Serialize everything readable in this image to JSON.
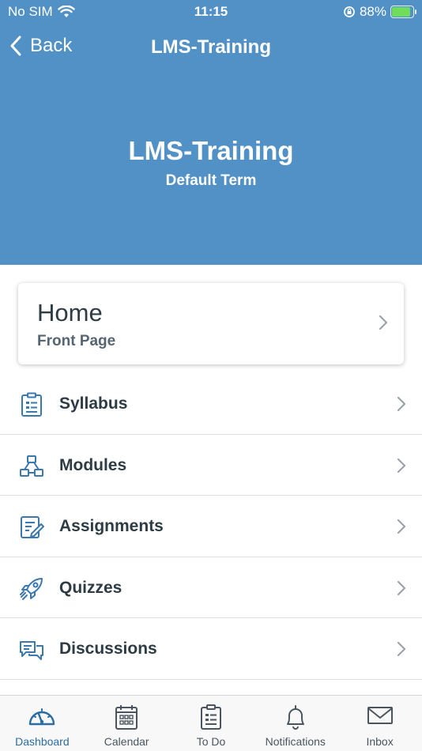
{
  "status": {
    "carrier": "No SIM",
    "time": "11:15",
    "battery": "88%",
    "battery_level": 0.88
  },
  "nav": {
    "back_label": "Back",
    "title": "LMS-Training"
  },
  "course": {
    "name": "LMS-Training",
    "term": "Default Term",
    "header_color": "#5291c5"
  },
  "home": {
    "title": "Home",
    "subtitle": "Front Page"
  },
  "menu": {
    "items": [
      {
        "label": "Syllabus",
        "icon": "syllabus-icon"
      },
      {
        "label": "Modules",
        "icon": "modules-icon"
      },
      {
        "label": "Assignments",
        "icon": "assignments-icon"
      },
      {
        "label": "Quizzes",
        "icon": "rocket-icon"
      },
      {
        "label": "Discussions",
        "icon": "discussions-icon"
      }
    ]
  },
  "tabs": [
    {
      "label": "Dashboard",
      "icon": "dashboard-icon",
      "active": true
    },
    {
      "label": "Calendar",
      "icon": "calendar-icon",
      "active": false
    },
    {
      "label": "To Do",
      "icon": "todo-icon",
      "active": false
    },
    {
      "label": "Notifications",
      "icon": "bell-icon",
      "active": false
    },
    {
      "label": "Inbox",
      "icon": "mail-icon",
      "active": false
    }
  ],
  "colors": {
    "accent": "#5291c5",
    "icon": "#3b78b0",
    "text": "#2d3b45",
    "tab_active": "#2b6ca3"
  }
}
